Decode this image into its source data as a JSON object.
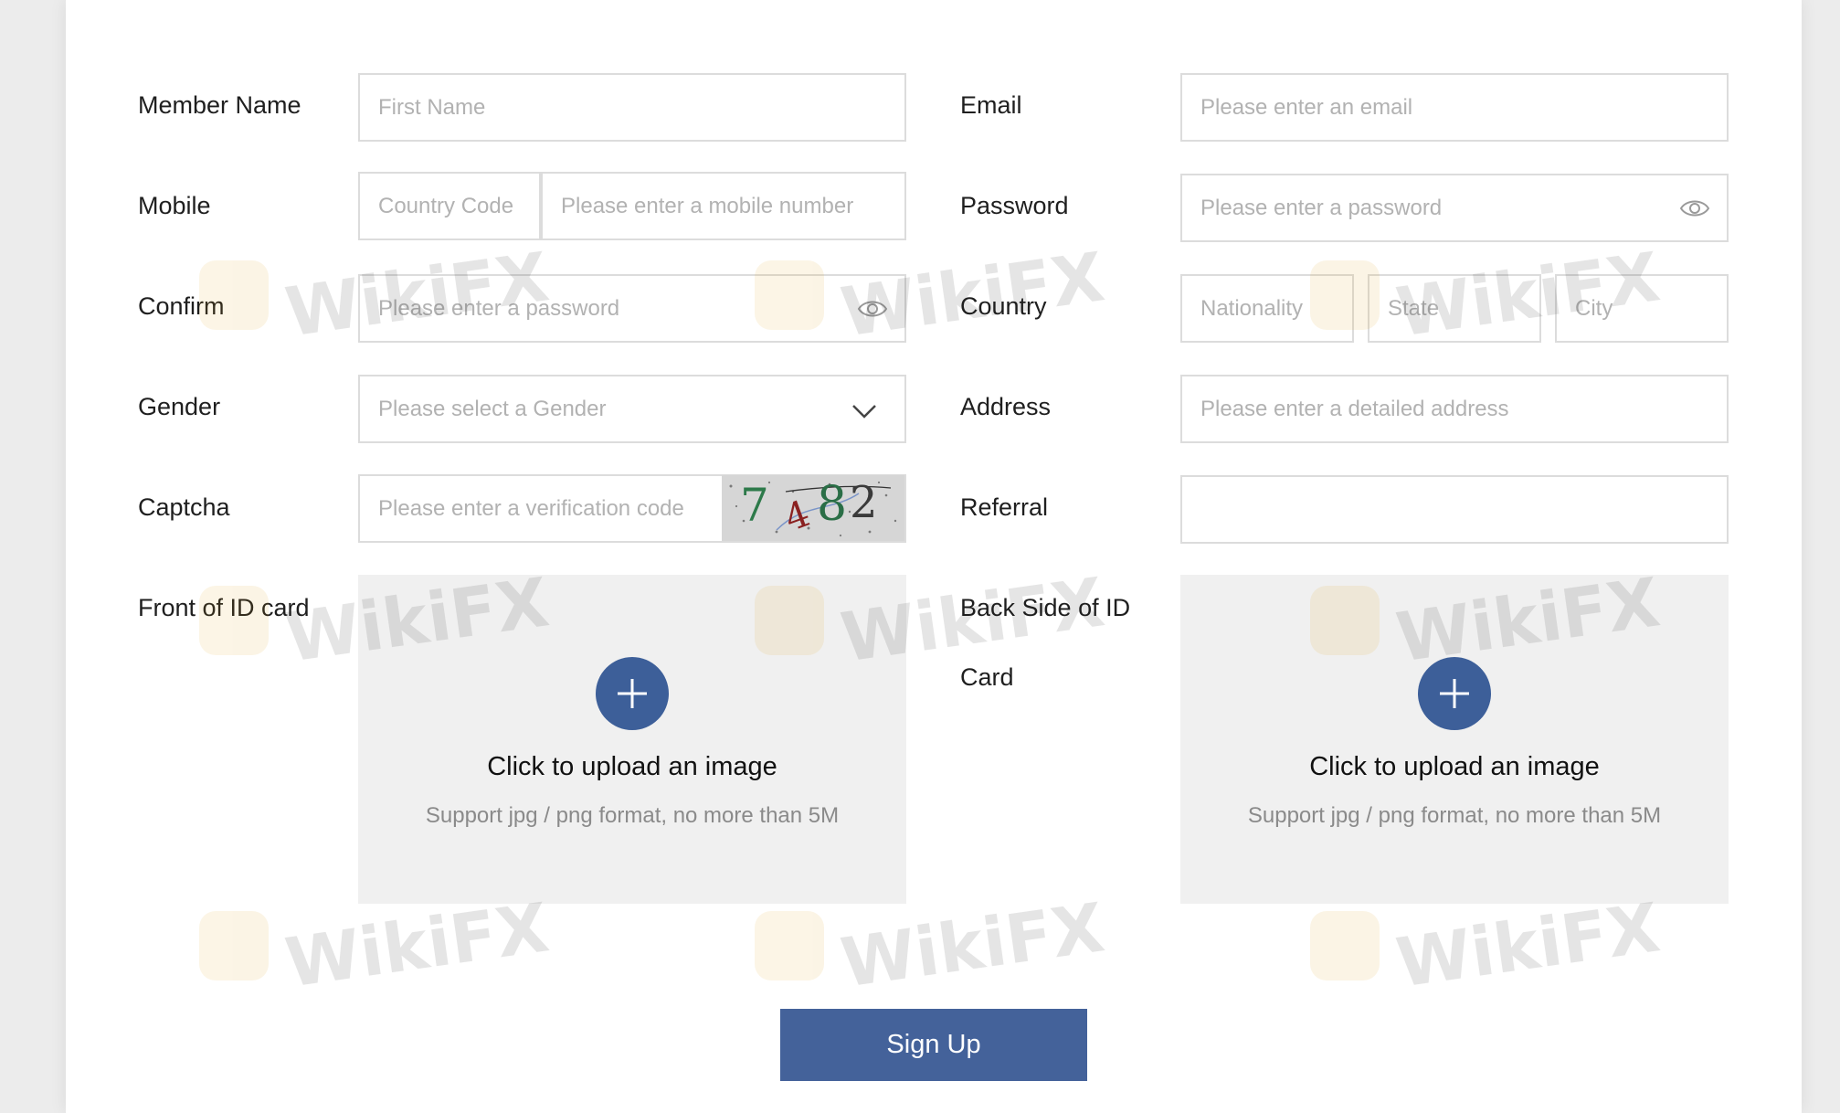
{
  "form": {
    "member_name": {
      "label": "Member Name",
      "placeholder": "First Name"
    },
    "email": {
      "label": "Email",
      "placeholder": "Please enter an email"
    },
    "mobile": {
      "label": "Mobile",
      "code_placeholder": "Country Code",
      "number_placeholder": "Please enter a mobile number"
    },
    "password": {
      "label": "Password",
      "placeholder": "Please enter a password"
    },
    "confirm": {
      "label": "Confirm",
      "placeholder": "Please enter a password"
    },
    "country": {
      "label": "Country",
      "nationality_placeholder": "Nationality",
      "state_placeholder": "State",
      "city_placeholder": "City"
    },
    "gender": {
      "label": "Gender",
      "placeholder": "Please select a Gender"
    },
    "address": {
      "label": "Address",
      "placeholder": "Please enter a detailed address"
    },
    "captcha": {
      "label": "Captcha",
      "placeholder": "Please enter a verification code",
      "code": "7482"
    },
    "referral": {
      "label": "Referral",
      "placeholder": ""
    },
    "front_id": {
      "label": "Front of ID card",
      "upload_title": "Click to upload an image",
      "upload_hint": "Support jpg / png format, no more than 5M"
    },
    "back_id": {
      "label_line1": "Back Side of ID",
      "label_line2": "Card",
      "upload_title": "Click to upload an image",
      "upload_hint": "Support jpg / png format, no more than 5M"
    },
    "submit_label": "Sign Up"
  },
  "watermark": {
    "text": "WikiFX"
  },
  "colors": {
    "primary": "#44629a",
    "border": "#dcdcdc",
    "placeholder": "#b2b2b2",
    "upload_bg": "#f0f0f0"
  }
}
